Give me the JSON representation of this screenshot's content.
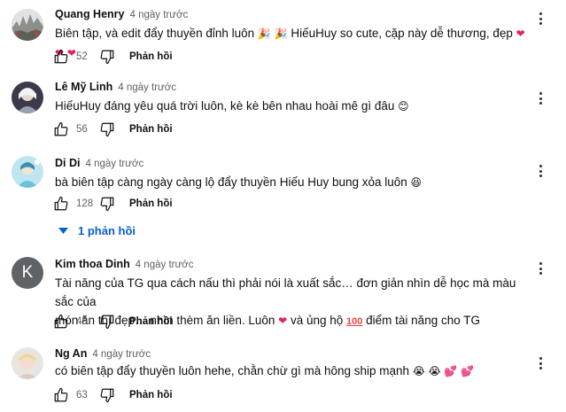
{
  "comments": [
    {
      "author": "Quang Henry",
      "time": "4 ngày trước",
      "text_parts": [
        "Biên tập, và edit đẩy thuyền đỉnh luôn ",
        " ",
        " HiếuHuy so cute, cặp này dễ thương, đẹp ",
        " ",
        " "
      ],
      "likes": "52",
      "reply_label": "Phản hồi"
    },
    {
      "author": "Lê Mỹ Linh",
      "time": "4 ngày trước",
      "text_parts": [
        "HiếuHuy đáng yêu quá trời luôn, kè kè bên nhau hoài mê gì đâu "
      ],
      "likes": "56",
      "reply_label": "Phản hồi"
    },
    {
      "author": "Di Di",
      "time": "4 ngày trước",
      "text_parts": [
        "bà biên tập càng ngày càng lộ đẩy thuyền Hiếu Huy bung xỏa luôn "
      ],
      "likes": "128",
      "reply_label": "Phản hồi",
      "replies_label": "1 phản hồi"
    },
    {
      "author": "Kim thoa Dinh",
      "time": "4 ngày trước",
      "avatar_letter": "K",
      "text_line1": "Tài năng của TG qua cách nấu thì phải nói là xuất sắc… đơn giản nhìn dễ học mà màu sắc của",
      "text_line2_parts": [
        "món ăn thì đẹp… nhìn thèm ăn liền. Luôn ",
        " và ủng hộ ",
        " điểm tài năng cho TG"
      ],
      "likes": "45",
      "reply_label": "Phản hồi"
    },
    {
      "author": "Ng An",
      "time": "4 ngày trước",
      "text_parts": [
        "có biên tập đẩy thuyền luôn hehe, chằn chừ gì mà hông ship mạnh "
      ],
      "likes": "63",
      "reply_label": "Phản hồi"
    }
  ],
  "emoji": {
    "party": "🎉",
    "heart": "❤",
    "smile": "😊",
    "laugh": "😆",
    "hundred": "100",
    "sob": "😭",
    "pink_hearts": "💕"
  },
  "colors": {
    "link_blue": "#065fd4",
    "heart_red": "#e0245e",
    "meta_gray": "#606060"
  }
}
